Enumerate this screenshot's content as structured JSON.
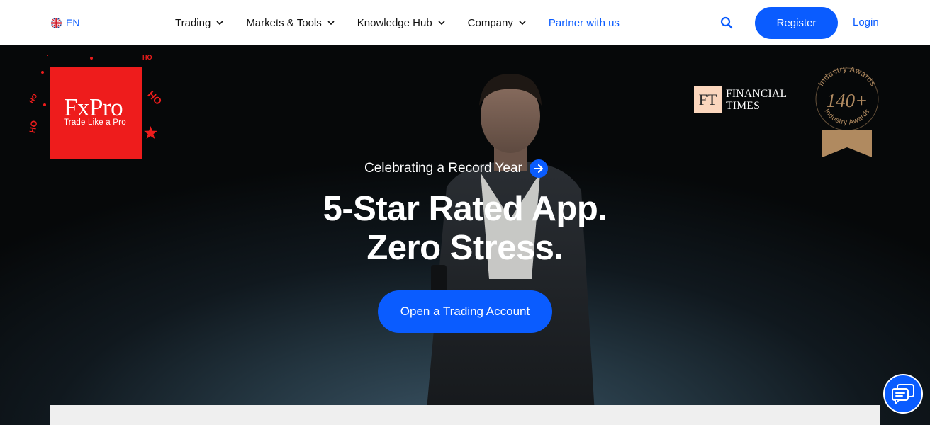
{
  "header": {
    "language": "EN",
    "nav": [
      {
        "label": "Trading"
      },
      {
        "label": "Markets & Tools"
      },
      {
        "label": "Knowledge Hub"
      },
      {
        "label": "Company"
      }
    ],
    "partner_label": "Partner with us",
    "register_label": "Register",
    "login_label": "Login"
  },
  "logo": {
    "brand": "FxPro",
    "tagline": "Trade Like a Pro",
    "decorations": [
      "HO",
      "HO",
      "HO",
      "HO"
    ]
  },
  "press": {
    "ft_mark": "FT",
    "ft_line1": "FINANCIAL",
    "ft_line2": "TIMES"
  },
  "award": {
    "count": "140+",
    "arc_top": "Industry Awards",
    "arc_bottom": "Industry Awards"
  },
  "hero": {
    "kicker": "Celebrating a Record Year",
    "headline_line1": "5-Star Rated App.",
    "headline_line2": "Zero Stress.",
    "cta_label": "Open a Trading Account"
  },
  "colors": {
    "accent": "#0a5cff",
    "brand_red": "#ee1c1c",
    "ft_pink": "#fbd6bd",
    "award_bronze": "#b08a60"
  }
}
